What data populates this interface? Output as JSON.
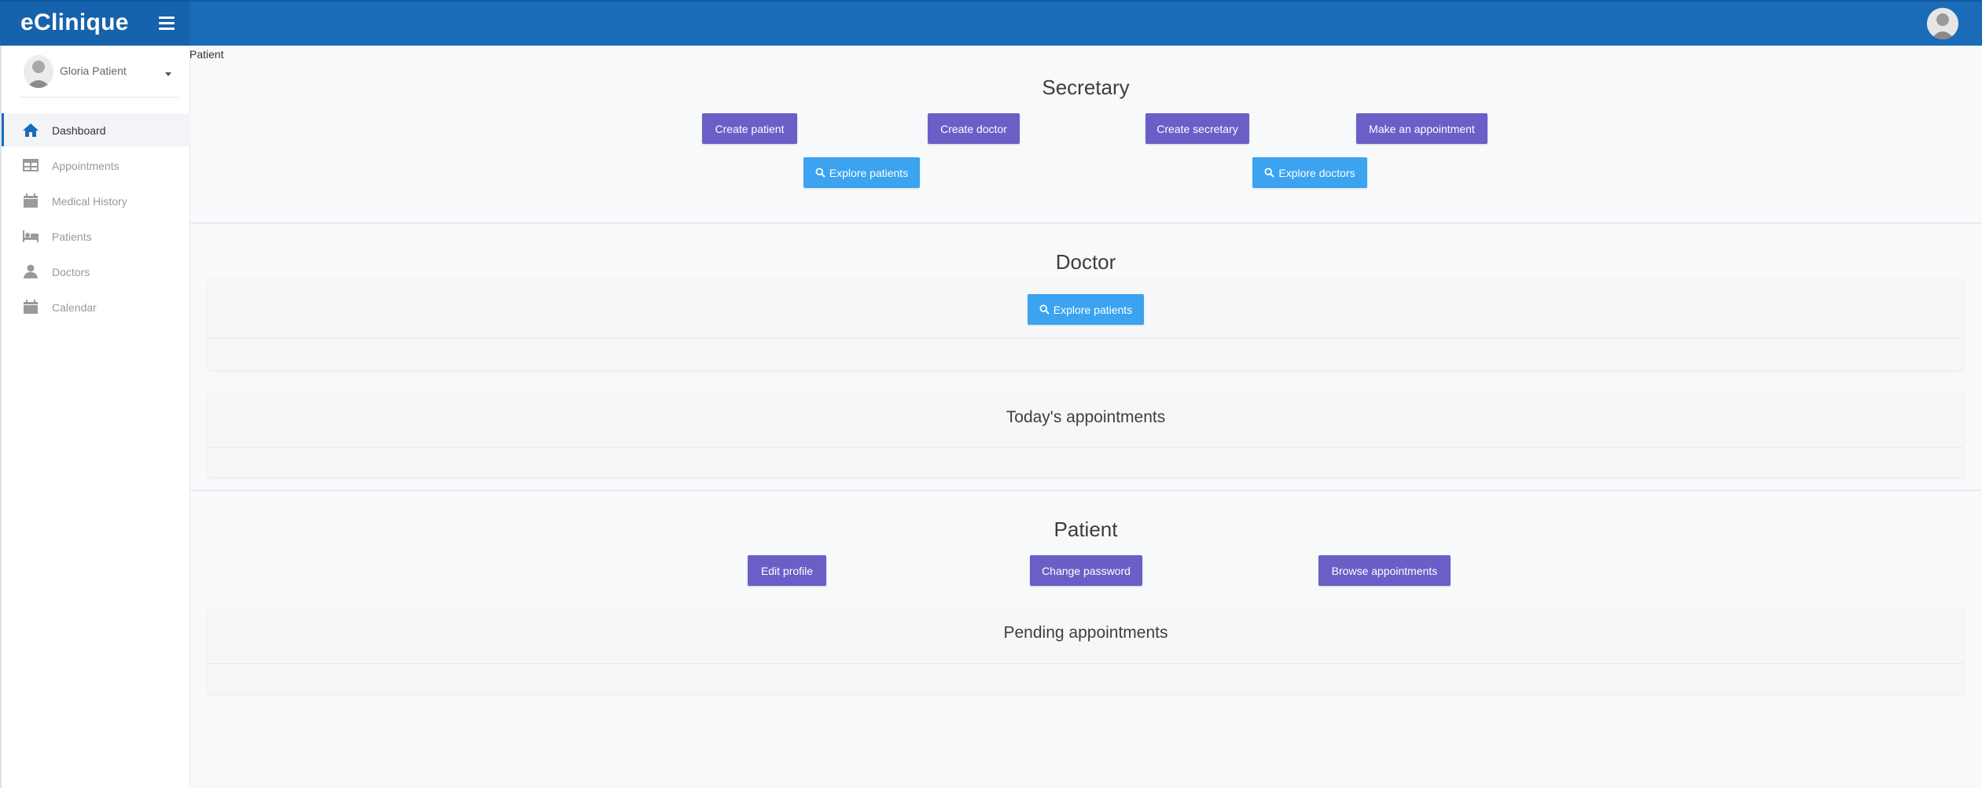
{
  "app": {
    "brand": "eClinique"
  },
  "sidebar": {
    "profile_name": "Gloria Patient",
    "items": [
      {
        "label": "Dashboard",
        "icon": "home-icon",
        "active": true
      },
      {
        "label": "Appointments",
        "icon": "table-icon"
      },
      {
        "label": "Medical History",
        "icon": "calendar-icon"
      },
      {
        "label": "Patients",
        "icon": "bed-icon"
      },
      {
        "label": "Doctors",
        "icon": "user-md-icon"
      },
      {
        "label": "Calendar",
        "icon": "calendar-icon"
      }
    ]
  },
  "breadcrumb": "Patient",
  "secretary": {
    "title": "Secretary",
    "create_patient": "Create patient",
    "create_doctor": "Create doctor",
    "create_secretary": "Create secretary",
    "make_appointment": "Make an appointment",
    "explore_patients": "Explore patients",
    "explore_doctors": "Explore doctors"
  },
  "doctor": {
    "title": "Doctor",
    "explore_patients": "Explore patients",
    "todays_appointments": "Today's appointments"
  },
  "patient": {
    "title": "Patient",
    "edit_profile": "Edit profile",
    "change_password": "Change password",
    "browse_appointments": "Browse appointments",
    "pending_appointments": "Pending appointments"
  },
  "colors": {
    "topbar": "#1a6bb8",
    "brand_block": "#1762ad",
    "purple_button": "#6a5fc7",
    "blue_button": "#3ba3ef"
  }
}
